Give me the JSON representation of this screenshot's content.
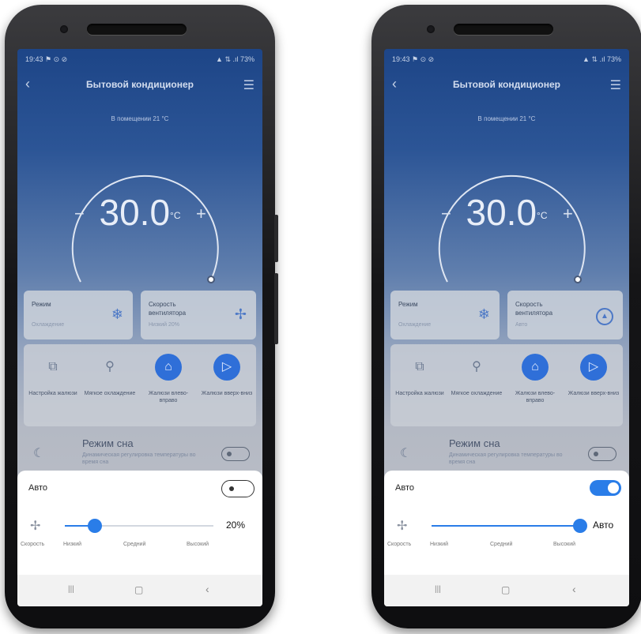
{
  "screens": [
    {
      "status_time": "19:43 ⚑ ⊙ ⊘",
      "status_right": "▲ ⇅ .ıl 73%",
      "title": "Бытовой кондиционер",
      "subtitle": "В помещении 21 °C",
      "temperature": "30.0",
      "temp_unit": "°C",
      "mode_card": {
        "title": "Режим",
        "sub": "Охлаждение"
      },
      "fan_card": {
        "title": "Скорость вентилятора",
        "sub": "Низкий 20%"
      },
      "functions": [
        {
          "label": "Настройка жалюзи",
          "icon": "louver-icon",
          "active": false
        },
        {
          "label": "Мягкое охлаждение",
          "icon": "soft-cool-icon",
          "active": false
        },
        {
          "label": "Жалюзи влево-вправо",
          "icon": "swing-lr-icon",
          "active": true
        },
        {
          "label": "Жалюзи вверх-вниз",
          "icon": "swing-ud-icon",
          "active": true
        }
      ],
      "sleep": {
        "title": "Режим сна",
        "desc": "Динамическая регулировка температуры во время сна"
      },
      "sheet": {
        "auto_label": "Авто",
        "auto_on": false,
        "speed_label": "Скорость",
        "slider_value": 0.2,
        "value_text": "20%",
        "scale": [
          "Низкий",
          "Средний",
          "Высокий"
        ]
      }
    },
    {
      "status_time": "19:43 ⚑ ⊙ ⊘",
      "status_right": "▲ ⇅ .ıl 73%",
      "title": "Бытовой кондиционер",
      "subtitle": "В помещении 21 °C",
      "temperature": "30.0",
      "temp_unit": "°C",
      "mode_card": {
        "title": "Режим",
        "sub": "Охлаждение"
      },
      "fan_card": {
        "title": "Скорость вентилятора",
        "sub": "Авто"
      },
      "functions": [
        {
          "label": "Настройка жалюзи",
          "icon": "louver-icon",
          "active": false
        },
        {
          "label": "Мягкое охлаждение",
          "icon": "soft-cool-icon",
          "active": false
        },
        {
          "label": "Жалюзи влево-вправо",
          "icon": "swing-lr-icon",
          "active": true
        },
        {
          "label": "Жалюзи вверх-вниз",
          "icon": "swing-ud-icon",
          "active": true
        }
      ],
      "sleep": {
        "title": "Режим сна",
        "desc": "Динамическая регулировка температуры во время сна"
      },
      "sheet": {
        "auto_label": "Авто",
        "auto_on": true,
        "speed_label": "Скорость",
        "slider_value": 1.0,
        "value_text": "Авто",
        "scale": [
          "Низкий",
          "Средний",
          "Высокий"
        ]
      }
    }
  ],
  "colors": {
    "accent": "#2a7de8",
    "screen_top": "#1d4587",
    "active_icon": "#2f6fd8"
  }
}
